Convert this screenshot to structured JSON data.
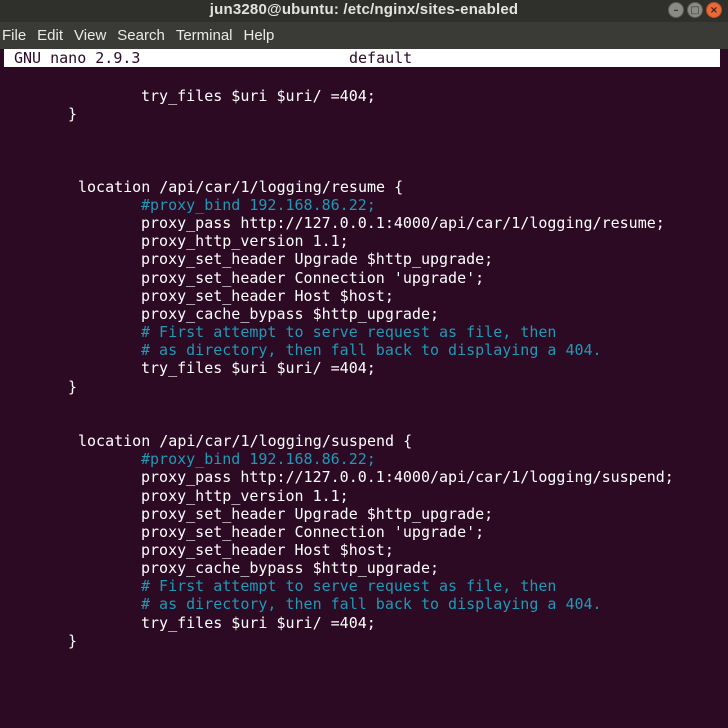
{
  "window": {
    "title": "jun3280@ubuntu: /etc/nginx/sites-enabled",
    "minimize_glyph": "–",
    "maximize_glyph": "□",
    "close_glyph": "×"
  },
  "menu": [
    "File",
    "Edit",
    "View",
    "Search",
    "Terminal",
    "Help"
  ],
  "nano": {
    "version": "GNU nano 2.9.3",
    "filename": "default"
  },
  "lines": [
    {
      "text": "try_files $uri $uri/ =404;",
      "indent": 141,
      "comment": false
    },
    {
      "text": "}",
      "indent": 68,
      "comment": false
    },
    {
      "text": "",
      "indent": 0,
      "comment": false
    },
    {
      "text": "",
      "indent": 0,
      "comment": false
    },
    {
      "text": "",
      "indent": 0,
      "comment": false
    },
    {
      "text": "location /api/car/1/logging/resume {",
      "indent": 78,
      "comment": false
    },
    {
      "text": "#proxy_bind 192.168.86.22;",
      "indent": 141,
      "comment": true
    },
    {
      "text": "proxy_pass http://127.0.0.1:4000/api/car/1/logging/resume;",
      "indent": 141,
      "comment": false
    },
    {
      "text": "proxy_http_version 1.1;",
      "indent": 141,
      "comment": false
    },
    {
      "text": "proxy_set_header Upgrade $http_upgrade;",
      "indent": 141,
      "comment": false
    },
    {
      "text": "proxy_set_header Connection 'upgrade';",
      "indent": 141,
      "comment": false
    },
    {
      "text": "proxy_set_header Host $host;",
      "indent": 141,
      "comment": false
    },
    {
      "text": "proxy_cache_bypass $http_upgrade;",
      "indent": 141,
      "comment": false
    },
    {
      "text": "# First attempt to serve request as file, then",
      "indent": 141,
      "comment": true
    },
    {
      "text": "# as directory, then fall back to displaying a 404.",
      "indent": 141,
      "comment": true
    },
    {
      "text": "try_files $uri $uri/ =404;",
      "indent": 141,
      "comment": false
    },
    {
      "text": "}",
      "indent": 68,
      "comment": false
    },
    {
      "text": "",
      "indent": 0,
      "comment": false
    },
    {
      "text": "",
      "indent": 0,
      "comment": false
    },
    {
      "text": "location /api/car/1/logging/suspend {",
      "indent": 78,
      "comment": false
    },
    {
      "text": "#proxy_bind 192.168.86.22;",
      "indent": 141,
      "comment": true
    },
    {
      "text": "proxy_pass http://127.0.0.1:4000/api/car/1/logging/suspend;",
      "indent": 141,
      "comment": false
    },
    {
      "text": "proxy_http_version 1.1;",
      "indent": 141,
      "comment": false
    },
    {
      "text": "proxy_set_header Upgrade $http_upgrade;",
      "indent": 141,
      "comment": false
    },
    {
      "text": "proxy_set_header Connection 'upgrade';",
      "indent": 141,
      "comment": false
    },
    {
      "text": "proxy_set_header Host $host;",
      "indent": 141,
      "comment": false
    },
    {
      "text": "proxy_cache_bypass $http_upgrade;",
      "indent": 141,
      "comment": false
    },
    {
      "text": "# First attempt to serve request as file, then",
      "indent": 141,
      "comment": true
    },
    {
      "text": "# as directory, then fall back to displaying a 404.",
      "indent": 141,
      "comment": true
    },
    {
      "text": "try_files $uri $uri/ =404;",
      "indent": 141,
      "comment": false
    },
    {
      "text": "}",
      "indent": 68,
      "comment": false
    }
  ],
  "colors": {
    "background": "#2c0a24",
    "text": "#ffffff",
    "comment": "#1e9ab6",
    "header_bg": "#ffffff",
    "titlebar_bg": "#2f2f2b",
    "menubar_bg": "#3a3a37",
    "close_button": "#e9693a"
  }
}
